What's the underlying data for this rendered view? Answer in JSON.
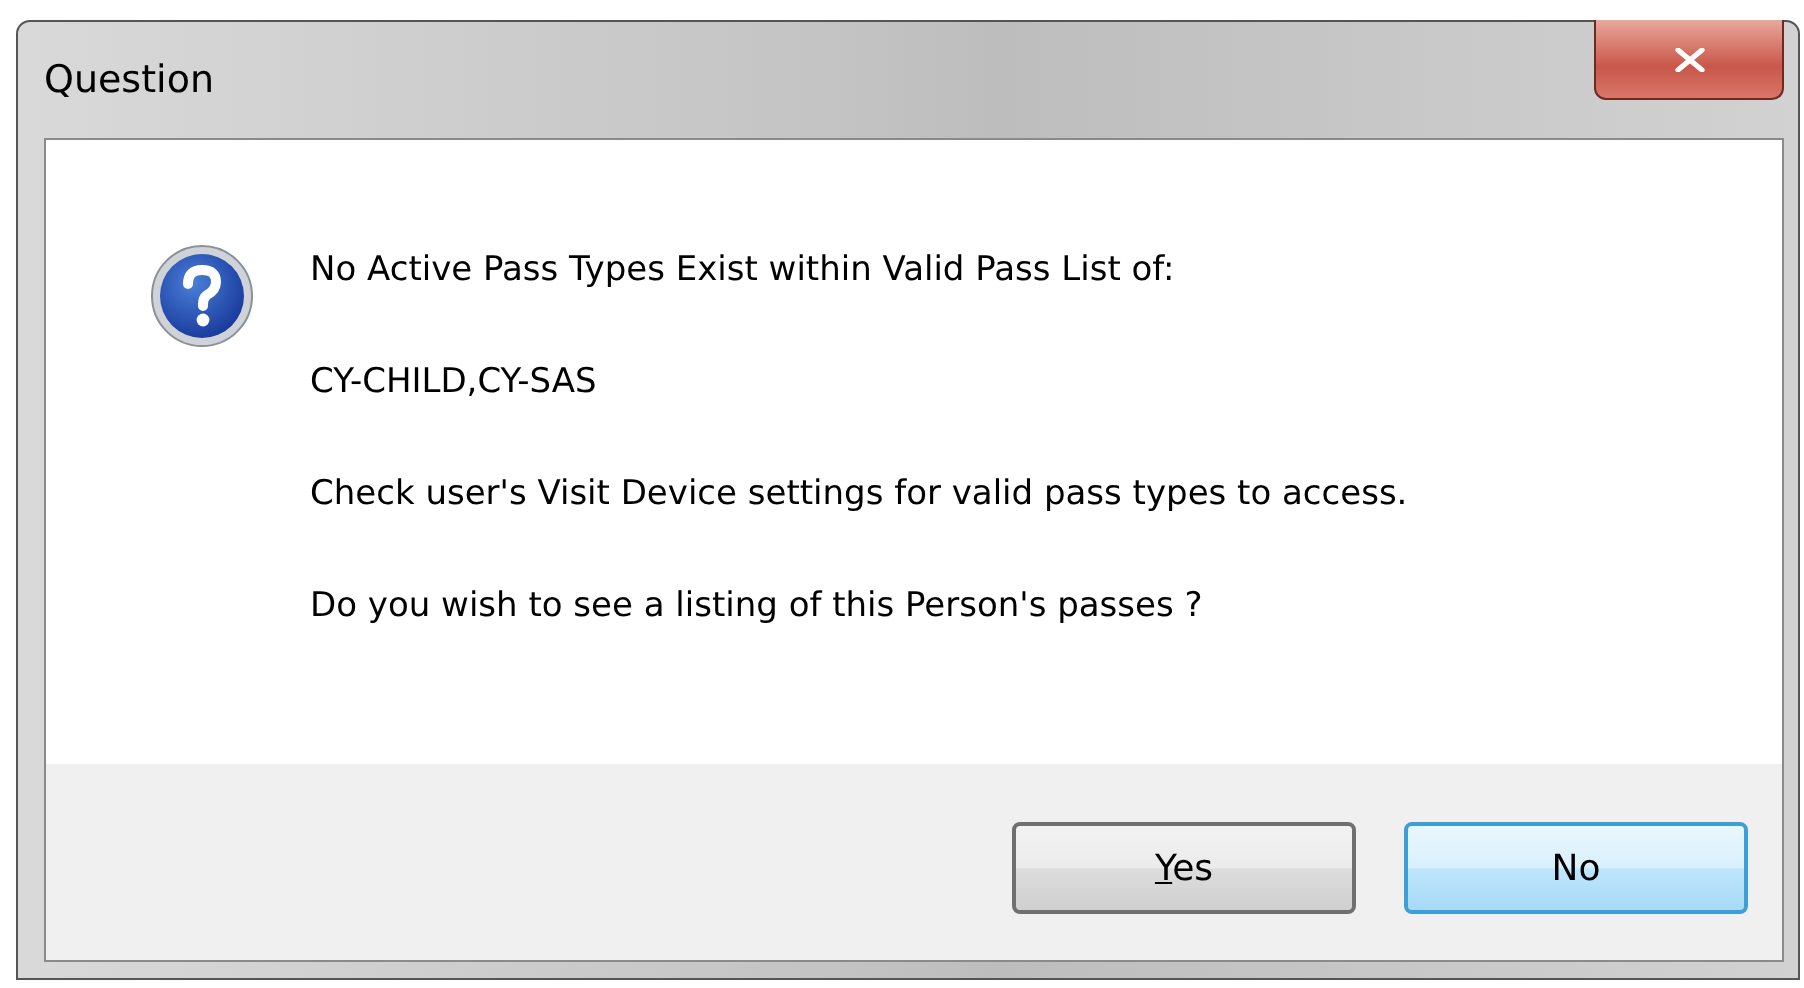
{
  "window": {
    "title": "Question"
  },
  "message": {
    "lines": [
      "No Active Pass Types Exist within Valid Pass List of:",
      "CY-CHILD,CY-SAS",
      "Check user's Visit Device settings for valid pass types to access.",
      "Do you wish to see a listing of this Person's passes ?"
    ]
  },
  "buttons": [
    {
      "label": "Yes",
      "mnemonic_underlined": true,
      "default": false
    },
    {
      "label": "No",
      "mnemonic_underlined": false,
      "default": true
    }
  ]
}
